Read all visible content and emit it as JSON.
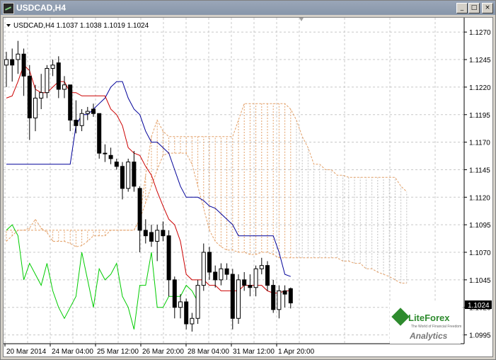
{
  "window": {
    "title": "USDCAD,H4",
    "controls": {
      "minimize": "_",
      "restore": "□",
      "close": "×"
    }
  },
  "chart": {
    "header": "USDCAD,H4  1.1037 1.1038 1.1019 1.1024",
    "current_price_label": "1.1024",
    "watermark": {
      "brand": "LiteForex",
      "tagline": "The World of Financial Freedom",
      "sub": "Analytics"
    }
  },
  "colors": {
    "tenkan": "#cc0000",
    "kijun": "#000099",
    "chikou": "#00cc00",
    "cloud": "#e3a068",
    "cloud_future": "#c0c0c0",
    "candle": "#000000",
    "grid": "#c8c8c8"
  },
  "chart_data": {
    "type": "candlestick",
    "y_axis": {
      "ticks": [
        "1.1270",
        "1.1245",
        "1.1220",
        "1.1195",
        "1.1170",
        "1.1145",
        "1.1120",
        "1.1095",
        "1.1070",
        "1.1045",
        "1.1020",
        "1.0995"
      ],
      "range": [
        1.0987,
        1.1283
      ]
    },
    "x_axis": {
      "ticks": [
        "20 Mar 2014",
        "24 Mar 04:00",
        "25 Mar 12:00",
        "26 Mar 20:00",
        "28 Mar 04:00",
        "31 Mar 12:00",
        "1 Apr 20:00"
      ]
    },
    "candles": [
      [
        1.124,
        1.1252,
        1.122,
        1.1245
      ],
      [
        1.1245,
        1.1255,
        1.1225,
        1.124
      ],
      [
        1.1245,
        1.1262,
        1.1232,
        1.125
      ],
      [
        1.125,
        1.1255,
        1.1212,
        1.123
      ],
      [
        1.123,
        1.124,
        1.1172,
        1.1192
      ],
      [
        1.1192,
        1.1222,
        1.118,
        1.121
      ],
      [
        1.121,
        1.1232,
        1.12,
        1.1215
      ],
      [
        1.1215,
        1.124,
        1.121,
        1.1237
      ],
      [
        1.1237,
        1.1245,
        1.123,
        1.124
      ],
      [
        1.1242,
        1.1248,
        1.121,
        1.1218
      ],
      [
        1.1218,
        1.123,
        1.121,
        1.1222
      ],
      [
        1.1222,
        1.1222,
        1.118,
        1.119
      ],
      [
        1.119,
        1.1208,
        1.1178,
        1.1185
      ],
      [
        1.1185,
        1.12,
        1.118,
        1.1196
      ],
      [
        1.1196,
        1.1202,
        1.119,
        1.1198
      ],
      [
        1.12,
        1.1205,
        1.1193,
        1.1196
      ],
      [
        1.1196,
        1.1196,
        1.1155,
        1.116
      ],
      [
        1.116,
        1.1168,
        1.1152,
        1.116
      ],
      [
        1.1158,
        1.1165,
        1.115,
        1.1155
      ],
      [
        1.1152,
        1.1155,
        1.1145,
        1.1148
      ],
      [
        1.1148,
        1.1152,
        1.1118,
        1.1128
      ],
      [
        1.1128,
        1.1155,
        1.1125,
        1.1152
      ],
      [
        1.1152,
        1.1162,
        1.1125,
        1.113
      ],
      [
        1.1128,
        1.113,
        1.107,
        1.109
      ],
      [
        1.109,
        1.11,
        1.1078,
        1.1085
      ],
      [
        1.1088,
        1.1095,
        1.1075,
        1.108
      ],
      [
        1.108,
        1.1095,
        1.1062,
        1.109
      ],
      [
        1.109,
        1.1098,
        1.108,
        1.1085
      ],
      [
        1.1085,
        1.109,
        1.103,
        1.1045
      ],
      [
        1.1045,
        1.1048,
        1.101,
        1.102
      ],
      [
        1.102,
        1.1032,
        1.101,
        1.1025
      ],
      [
        1.1025,
        1.1028,
        1.1,
        1.1005
      ],
      [
        1.1005,
        1.1015,
        1.0998,
        1.101
      ],
      [
        1.101,
        1.1045,
        1.1005,
        1.104
      ],
      [
        1.104,
        1.1078,
        1.1035,
        1.107
      ],
      [
        1.107,
        1.1075,
        1.1045,
        1.1052
      ],
      [
        1.1052,
        1.1058,
        1.1038,
        1.1045
      ],
      [
        1.1045,
        1.106,
        1.104,
        1.1055
      ],
      [
        1.1055,
        1.106,
        1.1045,
        1.105
      ],
      [
        1.105,
        1.1055,
        1.1,
        1.101
      ],
      [
        1.101,
        1.105,
        1.1005,
        1.1045
      ],
      [
        1.1045,
        1.1052,
        1.1035,
        1.104
      ],
      [
        1.104,
        1.105,
        1.103,
        1.1038
      ],
      [
        1.1038,
        1.1058,
        1.103,
        1.1055
      ],
      [
        1.1055,
        1.1065,
        1.105,
        1.1058
      ],
      [
        1.1058,
        1.1062,
        1.1035,
        1.104
      ],
      [
        1.104,
        1.1045,
        1.1015,
        1.1018
      ],
      [
        1.1018,
        1.104,
        1.101,
        1.1035
      ],
      [
        1.1035,
        1.104,
        1.102,
        1.1032
      ],
      [
        1.1037,
        1.1038,
        1.1019,
        1.1024
      ]
    ],
    "tenkan": [
      1.121,
      1.1212,
      1.1225,
      1.124,
      1.1235,
      1.1218,
      1.1215,
      1.1215,
      1.122,
      1.1225,
      1.1225,
      1.1215,
      1.1215,
      1.1212,
      1.1212,
      1.1212,
      1.1212,
      1.1212,
      1.12,
      1.1195,
      1.1185,
      1.1165,
      1.116,
      1.1158,
      1.1148,
      1.114,
      1.1125,
      1.1112,
      1.11,
      1.1095,
      1.108,
      1.105,
      1.1045,
      1.1045,
      1.1045,
      1.104,
      1.104,
      1.1035,
      1.1035,
      1.1035,
      1.1035,
      1.104,
      1.104,
      1.104,
      1.104,
      1.1035,
      1.1033,
      1.1033,
      1.1035,
      1.1035
    ],
    "kijun": [
      1.115,
      1.115,
      1.115,
      1.115,
      1.115,
      1.115,
      1.115,
      1.115,
      1.115,
      1.115,
      1.115,
      1.115,
      1.1185,
      1.1195,
      1.1195,
      1.12,
      1.1205,
      1.121,
      1.122,
      1.1225,
      1.1225,
      1.121,
      1.12,
      1.1195,
      1.118,
      1.117,
      1.117,
      1.1165,
      1.116,
      1.1145,
      1.113,
      1.112,
      1.112,
      1.112,
      1.1117,
      1.1112,
      1.111,
      1.1105,
      1.11,
      1.1095,
      1.1085,
      1.1085,
      1.1085,
      1.1085,
      1.1085,
      1.1085,
      1.1085,
      1.107,
      1.105,
      1.1048
    ],
    "chikou": [
      1.109,
      1.1095,
      1.1085,
      1.1045,
      1.106,
      1.105,
      1.104,
      1.106,
      1.1035,
      1.102,
      1.101,
      1.102,
      1.103,
      1.107,
      1.1045,
      1.102,
      1.1055,
      1.1045,
      1.105,
      1.106,
      1.103,
      1.102,
      1.1,
      1.104,
      1.104,
      1.107,
      1.102,
      1.102,
      1.103,
      1.103,
      1.103,
      1.104,
      1.1035,
      1.1025
    ],
    "senkou_a": [
      1.108,
      1.1085,
      1.109,
      1.109,
      1.1092,
      1.11,
      1.1092,
      1.1088,
      1.108,
      1.108,
      1.108,
      1.1078,
      1.1075,
      1.1076,
      1.108,
      1.1085,
      1.1085,
      1.1085,
      1.109,
      1.109,
      1.109,
      1.109,
      1.109,
      1.11,
      1.1115,
      1.113,
      1.1145,
      1.1158,
      1.116,
      1.116,
      1.116,
      1.116,
      1.115,
      1.113,
      1.111,
      1.109,
      1.108,
      1.1075,
      1.1072,
      1.1072,
      1.107,
      1.107,
      1.1068,
      1.1068,
      1.107,
      1.107,
      1.1068,
      1.1065,
      1.1065,
      1.1065,
      1.1065,
      1.1065,
      1.1065,
      1.1065,
      1.1065,
      1.1065,
      1.1065,
      1.1065,
      1.1062,
      1.1062,
      1.106,
      1.106,
      1.1055,
      1.1055,
      1.1052,
      1.105,
      1.1048,
      1.1045,
      1.1042,
      1.1042
    ],
    "senkou_b": [
      1.109,
      1.109,
      1.109,
      1.109,
      1.109,
      1.109,
      1.109,
      1.109,
      1.109,
      1.109,
      1.109,
      1.109,
      1.109,
      1.109,
      1.109,
      1.109,
      1.109,
      1.109,
      1.109,
      1.109,
      1.109,
      1.109,
      1.109,
      1.11,
      1.114,
      1.1175,
      1.119,
      1.118,
      1.1175,
      1.1175,
      1.1175,
      1.1175,
      1.1175,
      1.1175,
      1.1175,
      1.1175,
      1.1175,
      1.1175,
      1.1175,
      1.1175,
      1.119,
      1.1205,
      1.1205,
      1.1205,
      1.1205,
      1.1205,
      1.1205,
      1.1205,
      1.1205,
      1.12,
      1.119,
      1.1175,
      1.1165,
      1.115,
      1.115,
      1.1145,
      1.1145,
      1.114,
      1.114,
      1.1138,
      1.1138,
      1.1138,
      1.1138,
      1.1138,
      1.1138,
      1.1138,
      1.1138,
      1.1138,
      1.113,
      1.1125
    ]
  }
}
